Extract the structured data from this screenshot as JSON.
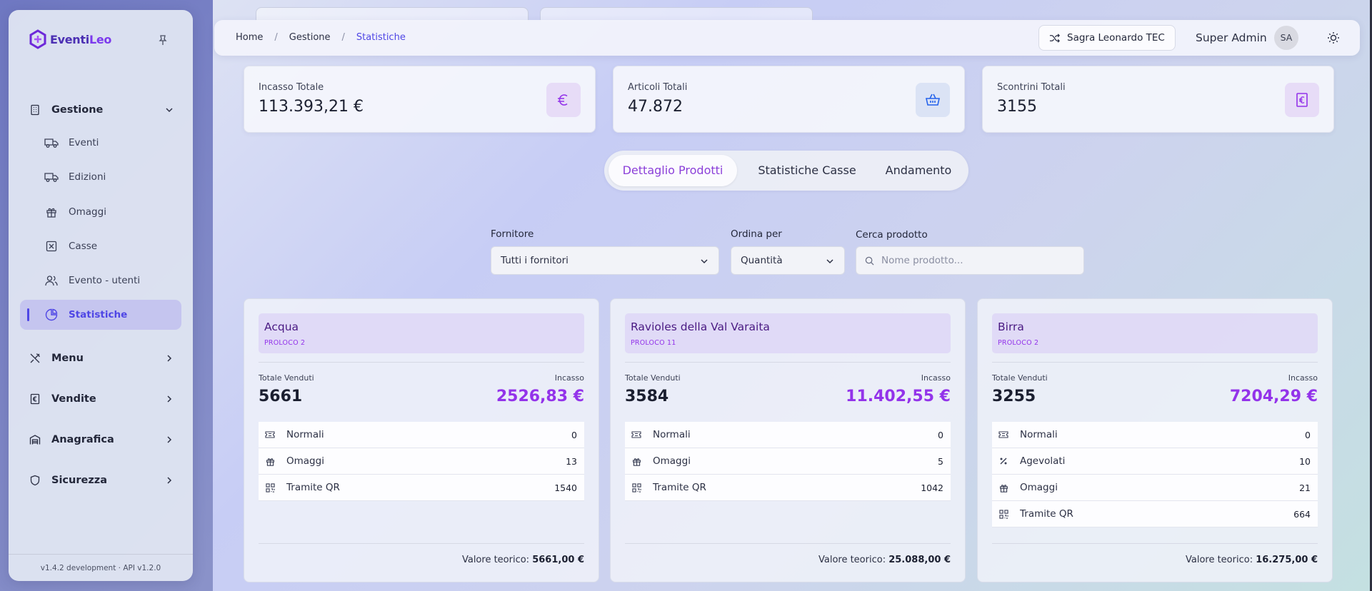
{
  "app": {
    "logo_text": "EventiLeo",
    "logo_a": "Eventi",
    "logo_b": "Leo",
    "version": "v1.4.2 development · API v1.2.0"
  },
  "sidebar": {
    "groups": [
      {
        "label": "Gestione",
        "icon": "building-icon",
        "expanded": true
      },
      {
        "label": "Menu",
        "icon": "utensils-icon",
        "expanded": false
      },
      {
        "label": "Vendite",
        "icon": "receipt-euro-icon",
        "expanded": false
      },
      {
        "label": "Anagrafica",
        "icon": "warehouse-icon",
        "expanded": false
      },
      {
        "label": "Sicurezza",
        "icon": "shield-icon",
        "expanded": false
      }
    ],
    "items": [
      {
        "label": "Eventi",
        "icon": "truck-icon"
      },
      {
        "label": "Edizioni",
        "icon": "truck-icon"
      },
      {
        "label": "Omaggi",
        "icon": "gift-icon"
      },
      {
        "label": "Casse",
        "icon": "register-icon"
      },
      {
        "label": "Evento - utenti",
        "icon": "users-icon"
      },
      {
        "label": "Statistiche",
        "icon": "pie-chart-icon",
        "active": true
      }
    ]
  },
  "header": {
    "breadcrumb": [
      "Home",
      "Gestione",
      "Statistiche"
    ],
    "event_name": "Sagra Leonardo TEC",
    "user_name": "Super Admin",
    "user_initials": "SA"
  },
  "kpis": [
    {
      "label": "Incasso Totale",
      "value": "113.393,21 €",
      "icon": "euro-icon",
      "color": "#9333ea",
      "bg": "#e7dcf7"
    },
    {
      "label": "Articoli Totali",
      "value": "47.872",
      "icon": "basket-icon",
      "color": "#2563eb",
      "bg": "#dbe3f5"
    },
    {
      "label": "Scontrini Totali",
      "value": "3155",
      "icon": "receipt-icon",
      "color": "#9333ea",
      "bg": "#e7dcf7"
    }
  ],
  "tabs": [
    {
      "label": "Dettaglio Prodotti",
      "active": true
    },
    {
      "label": "Statistiche Casse",
      "active": false
    },
    {
      "label": "Andamento",
      "active": false
    }
  ],
  "filters": {
    "supplier": {
      "label": "Fornitore",
      "value": "Tutti i fornitori"
    },
    "order": {
      "label": "Ordina per",
      "value": "Quantità"
    },
    "search": {
      "label": "Cerca prodotto",
      "placeholder": "Nome prodotto..."
    }
  },
  "products": [
    {
      "name": "Acqua",
      "vendor": "PROLOCO 2",
      "sold_label": "Totale Venduti",
      "sold": "5661",
      "revenue_label": "Incasso",
      "revenue": "2526,83 €",
      "rows": [
        {
          "label": "Normali",
          "value": "0",
          "icon": "ticket-icon"
        },
        {
          "label": "Omaggi",
          "value": "13",
          "icon": "gift-icon"
        },
        {
          "label": "Tramite QR",
          "value": "1540",
          "icon": "qr-icon"
        }
      ],
      "theoretical_label": "Valore teorico:",
      "theoretical": "5661,00 €"
    },
    {
      "name": "Ravioles della Val Varaita",
      "vendor": "PROLOCO 11",
      "sold_label": "Totale Venduti",
      "sold": "3584",
      "revenue_label": "Incasso",
      "revenue": "11.402,55 €",
      "rows": [
        {
          "label": "Normali",
          "value": "0",
          "icon": "ticket-icon"
        },
        {
          "label": "Omaggi",
          "value": "5",
          "icon": "gift-icon"
        },
        {
          "label": "Tramite QR",
          "value": "1042",
          "icon": "qr-icon"
        }
      ],
      "theoretical_label": "Valore teorico:",
      "theoretical": "25.088,00 €"
    },
    {
      "name": "Birra",
      "vendor": "PROLOCO 2",
      "sold_label": "Totale Venduti",
      "sold": "3255",
      "revenue_label": "Incasso",
      "revenue": "7204,29 €",
      "rows": [
        {
          "label": "Normali",
          "value": "0",
          "icon": "ticket-icon"
        },
        {
          "label": "Agevolati",
          "value": "10",
          "icon": "percent-icon"
        },
        {
          "label": "Omaggi",
          "value": "21",
          "icon": "gift-icon"
        },
        {
          "label": "Tramite QR",
          "value": "664",
          "icon": "qr-icon"
        }
      ],
      "theoretical_label": "Valore teorico:",
      "theoretical": "16.275,00 €"
    }
  ]
}
